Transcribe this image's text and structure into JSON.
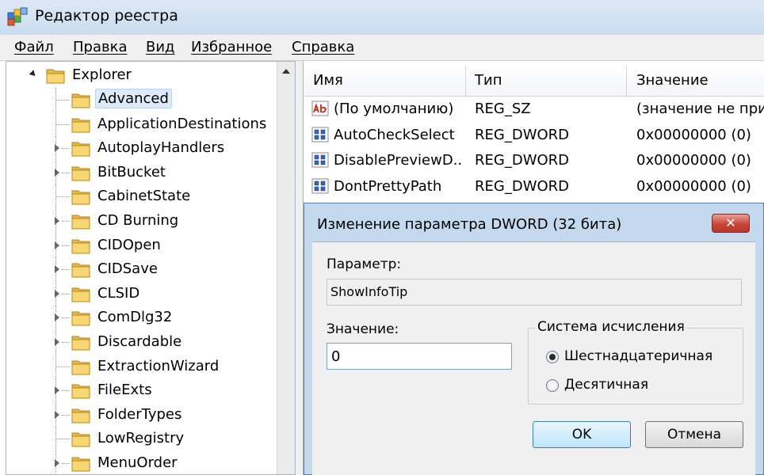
{
  "window": {
    "title": "Редактор реестра",
    "icon": "registry-editor-icon"
  },
  "menu": [
    {
      "label": "Файл"
    },
    {
      "label": "Правка"
    },
    {
      "label": "Вид"
    },
    {
      "label": "Избранное"
    },
    {
      "label": "Справка"
    }
  ],
  "tree": {
    "parent": "Explorer",
    "children": [
      {
        "label": "Advanced",
        "selected": true,
        "expandable": false
      },
      {
        "label": "ApplicationDestinations",
        "expandable": false
      },
      {
        "label": "AutoplayHandlers",
        "expandable": true
      },
      {
        "label": "BitBucket",
        "expandable": true
      },
      {
        "label": "CabinetState",
        "expandable": false
      },
      {
        "label": "CD Burning",
        "expandable": true
      },
      {
        "label": "CIDOpen",
        "expandable": true
      },
      {
        "label": "CIDSave",
        "expandable": true
      },
      {
        "label": "CLSID",
        "expandable": true
      },
      {
        "label": "ComDlg32",
        "expandable": true
      },
      {
        "label": "Discardable",
        "expandable": true
      },
      {
        "label": "ExtractionWizard",
        "expandable": false
      },
      {
        "label": "FileExts",
        "expandable": true
      },
      {
        "label": "FolderTypes",
        "expandable": true
      },
      {
        "label": "LowRegistry",
        "expandable": false
      },
      {
        "label": "MenuOrder",
        "expandable": true
      }
    ]
  },
  "list": {
    "columns": [
      "Имя",
      "Тип",
      "Значение"
    ],
    "rows": [
      {
        "icon": "string-value-icon",
        "name": "(По умолчанию)",
        "type": "REG_SZ",
        "value": "(значение не при"
      },
      {
        "icon": "dword-value-icon",
        "name": "AutoCheckSelect",
        "type": "REG_DWORD",
        "value": "0x00000000 (0)"
      },
      {
        "icon": "dword-value-icon",
        "name": "DisablePreviewD...",
        "type": "REG_DWORD",
        "value": "0x00000000 (0)"
      },
      {
        "icon": "dword-value-icon",
        "name": "DontPrettyPath",
        "type": "REG_DWORD",
        "value": "0x00000000 (0)"
      }
    ]
  },
  "dialog": {
    "title": "Изменение параметра DWORD (32 бита)",
    "close_glyph": "✕",
    "param_label": "Параметр:",
    "param_value": "ShowInfoTip",
    "value_label": "Значение:",
    "value": "0",
    "radix_label": "Система исчисления",
    "radix_options": [
      {
        "label": "Шестнадцатеричная",
        "checked": true
      },
      {
        "label": "Десятичная",
        "checked": false
      }
    ],
    "ok_label": "OK",
    "cancel_label": "Отмена"
  }
}
